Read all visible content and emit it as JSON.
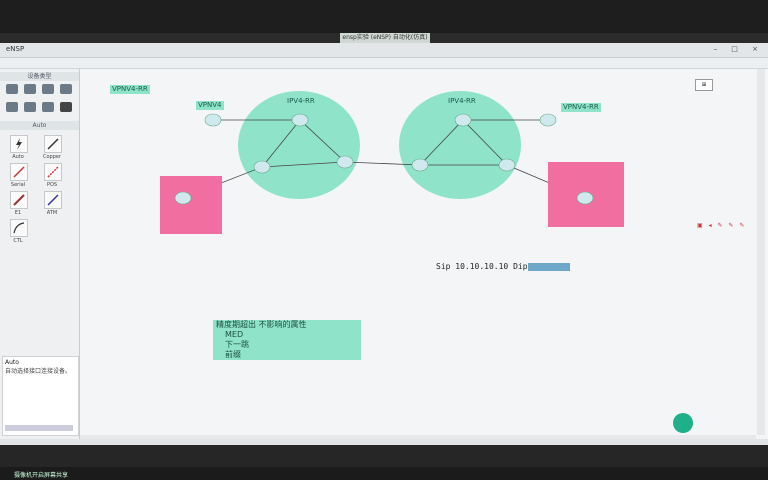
{
  "window": {
    "tab_title": "ensp实验 (eNSP) 自动化(仿真)",
    "app_title": "eNSP"
  },
  "left_panel": {
    "section_devices": "设备类型",
    "section_links": "Auto",
    "tools": [
      {
        "label": "Auto"
      },
      {
        "label": "Copper"
      },
      {
        "label": "Serial"
      },
      {
        "label": "POS"
      },
      {
        "label": "E1"
      },
      {
        "label": "ATM"
      },
      {
        "label": "CTL"
      }
    ],
    "info_title": "Auto",
    "info_text": "自动选择接口连接设备。"
  },
  "canvas": {
    "labels": {
      "vpnv4_rr_left": "VPNV4-RR",
      "vpnv4_left": "VPNV4",
      "ipv4_rr_left": "IPV4-RR",
      "ipv4_rr_right": "IPV4-RR",
      "vpnv4_rr_right": "VPNV4-RR"
    },
    "note_lines": [
      "精度期超出 不影响的属性",
      "MED",
      "下一跳",
      "前缀"
    ],
    "sip_text": "Sip 10.10.10.10 Dip"
  },
  "colors": {
    "cloud": "#8fe3c9",
    "pink": "#f06ea0",
    "accent": "#1fb08a"
  },
  "taskbar": {
    "text": "摄像机开启屏幕共享"
  }
}
